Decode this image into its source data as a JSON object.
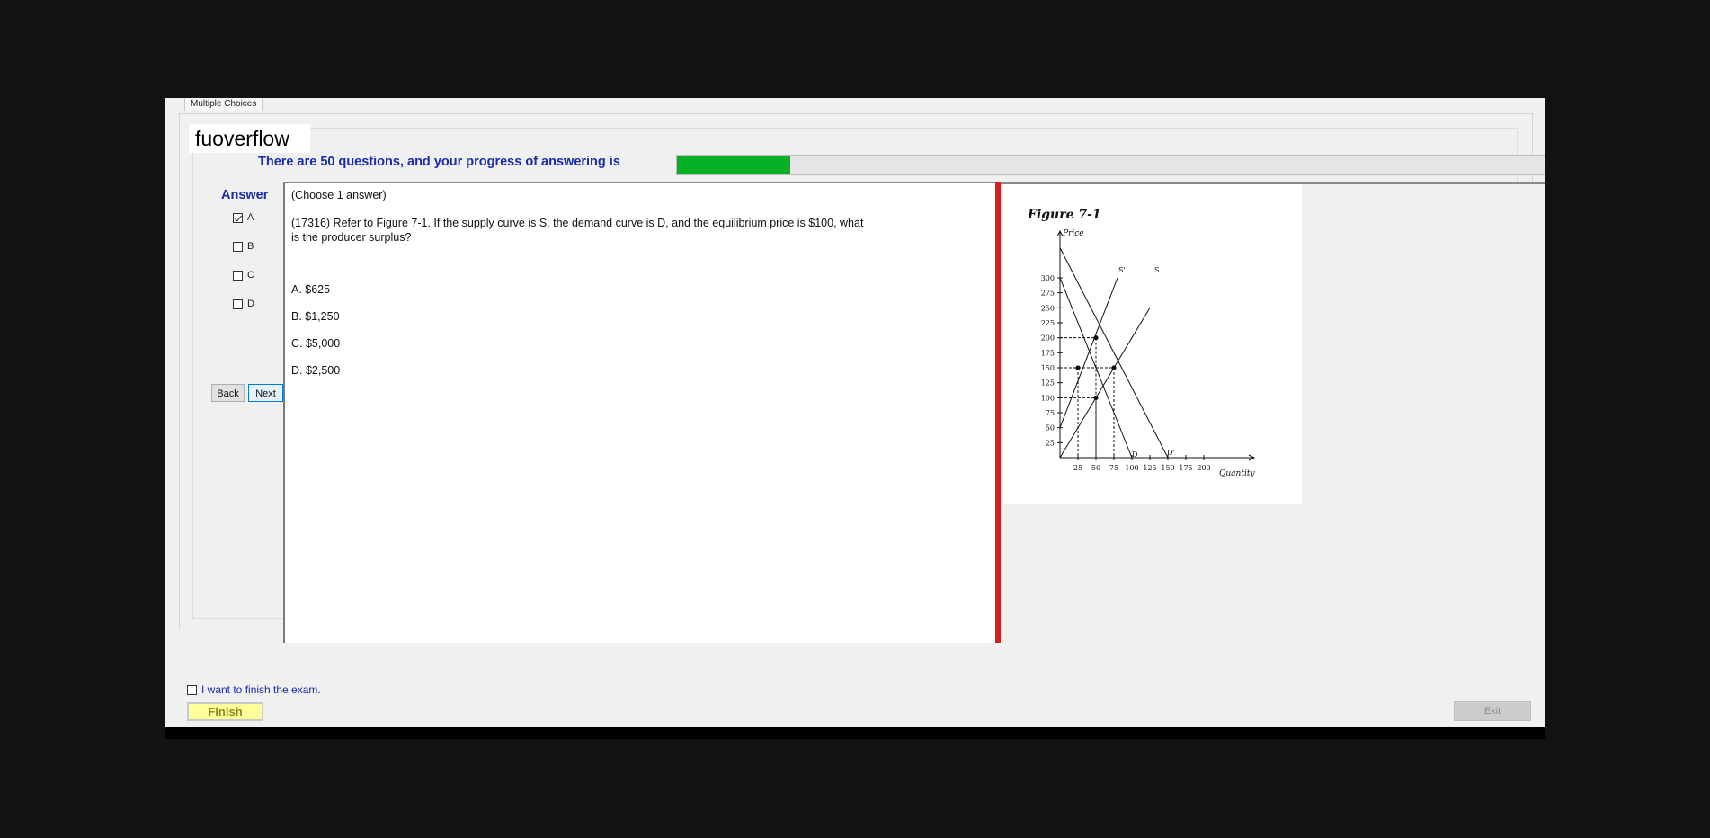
{
  "window": {
    "tab_label": "Multiple Choices",
    "watermark": "fuoverflow"
  },
  "progress": {
    "label": "There are 50 questions, and your progress of answering is",
    "fraction": 0.13
  },
  "answer_panel": {
    "title": "Answer",
    "options": [
      {
        "label": "A",
        "checked": true
      },
      {
        "label": "B",
        "checked": false
      },
      {
        "label": "C",
        "checked": false
      },
      {
        "label": "D",
        "checked": false
      }
    ],
    "back_label": "Back",
    "next_label": "Next"
  },
  "question": {
    "instruction": "(Choose 1 answer)",
    "text": "(17316)  Refer to Figure 7-1.  If the supply curve is S, the demand curve is D, and the equilibrium price is $100, what is the producer surplus?",
    "choices": [
      "A.  $625",
      "B.  $1,250",
      "C.  $5,000",
      "D.  $2,500"
    ]
  },
  "figure": {
    "title": "Figure 7-1",
    "y_label": "Price",
    "x_label": "Quantity",
    "y_ticks": [
      "300",
      "275",
      "250",
      "225",
      "200",
      "175",
      "150",
      "125",
      "100",
      "75",
      "50",
      "25"
    ],
    "x_ticks": [
      "25",
      "50",
      "75",
      "100",
      "125",
      "150",
      "175",
      "200"
    ],
    "curve_labels": {
      "s_prime": "S'",
      "s": "S",
      "d": "D",
      "d_prime": "D'"
    },
    "curves": {
      "D": [
        [
          0,
          300
        ],
        [
          100,
          0
        ]
      ],
      "D_prime": [
        [
          0,
          350
        ],
        [
          150,
          0
        ]
      ],
      "S_prime": [
        [
          0,
          50
        ],
        [
          80,
          300
        ]
      ],
      "S": [
        [
          0,
          0
        ],
        [
          125,
          250
        ]
      ]
    },
    "equilibrium_points": [
      [
        25,
        150
      ],
      [
        50,
        200
      ],
      [
        50,
        100
      ],
      [
        75,
        150
      ]
    ]
  },
  "footer": {
    "finish_checkbox_label": "I want to finish the exam.",
    "finish_button_label": "Finish",
    "exit_button_label": "Exit"
  }
}
